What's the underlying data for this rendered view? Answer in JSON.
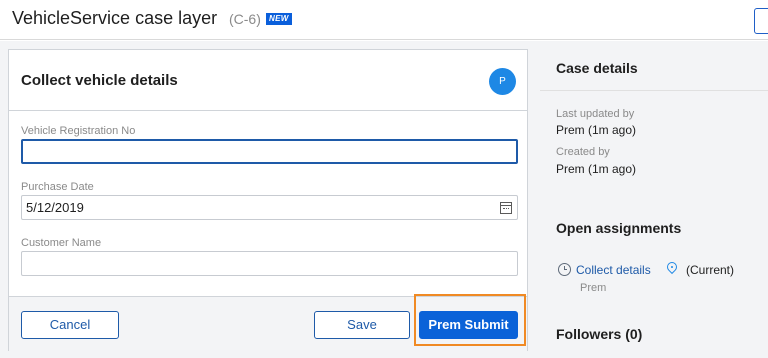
{
  "header": {
    "title": "VehicleService case layer",
    "case_id": "(C-6)",
    "badge": "NEW"
  },
  "form": {
    "title": "Collect vehicle details",
    "avatar_initial": "P",
    "fields": [
      {
        "label": "Vehicle Registration No",
        "value": ""
      },
      {
        "label": "Purchase Date",
        "value": "5/12/2019"
      },
      {
        "label": "Customer Name",
        "value": ""
      }
    ],
    "buttons": {
      "cancel": "Cancel",
      "save": "Save",
      "submit": "Prem Submit"
    }
  },
  "sidebar": {
    "case_details_heading": "Case details",
    "last_updated_label": "Last updated by",
    "last_updated_value": "Prem (1m ago)",
    "created_label": "Created by",
    "created_value": "Prem (1m ago)",
    "open_assignments_heading": "Open assignments",
    "assignment_link": "Collect details",
    "assignment_status": "(Current)",
    "assignment_owner": "Prem",
    "followers_heading": "Followers (0)"
  },
  "colors": {
    "primary": "#0a62d8",
    "highlight": "#f08a24",
    "avatar": "#1e88e5"
  },
  "icons": [
    "calendar-icon",
    "clock-icon",
    "location-pin-icon"
  ]
}
